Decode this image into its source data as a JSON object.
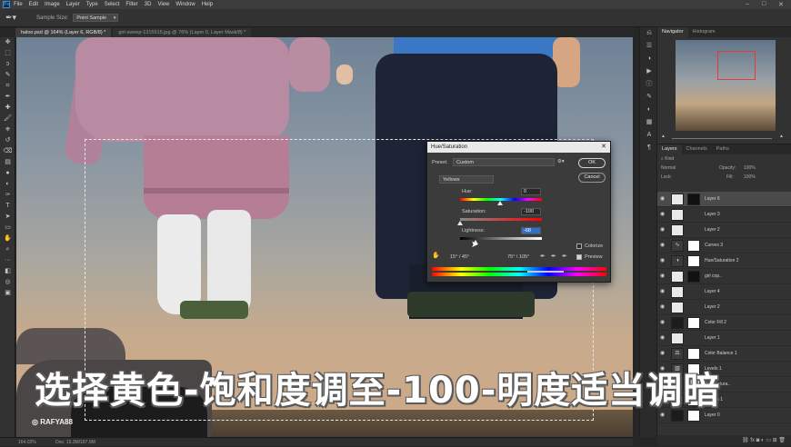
{
  "menubar": {
    "logo": "Ps",
    "items": [
      "File",
      "Edit",
      "Image",
      "Layer",
      "Type",
      "Select",
      "Filter",
      "3D",
      "View",
      "Window",
      "Help"
    ]
  },
  "options": {
    "sample_size_label": "Sample Size:",
    "sample_size_value": "Point Sample"
  },
  "tabs": [
    {
      "label": "haloo.psd @ 164% (Layer 6, RGB/8) *"
    },
    {
      "label": "girl-sweep-1315515.jpg @ 76% (Layer 0, Layer Mask/8) *"
    }
  ],
  "status": {
    "zoom": "164.02%",
    "doc": "Doc: 15.3M/187.9M"
  },
  "dialog": {
    "title": "Hue/Saturation",
    "preset_label": "Preset:",
    "preset_value": "Custom",
    "ok": "OK",
    "cancel": "Cancel",
    "channel": "Yellows",
    "hue_label": "Hue:",
    "hue_value": "0",
    "saturation_label": "Saturation:",
    "saturation_value": "-100",
    "lightness_label": "Lightness:",
    "lightness_value": "-68",
    "colorize_label": "Colorize",
    "preview_label": "Preview",
    "range_left": "15° / 45°",
    "range_right": "75° \\ 105°"
  },
  "navigator": {
    "tabs": [
      "Navigator",
      "Histogram"
    ]
  },
  "layers_panel": {
    "tabs": [
      "Layers",
      "Channels",
      "Paths"
    ],
    "kind_label": "Kind",
    "blend_mode": "Normal",
    "opacity_label": "Opacity:",
    "opacity_value": "100%",
    "lock_label": "Lock:",
    "fill_label": "Fill:",
    "fill_value": "100%",
    "layers": [
      {
        "name": "Layer 6",
        "selected": true
      },
      {
        "name": "Layer 3",
        "selected": false
      },
      {
        "name": "Layer 2",
        "selected": false
      },
      {
        "name": "Curves 3",
        "selected": false
      },
      {
        "name": "Hue/Saturation 2",
        "selected": false
      },
      {
        "name": "girl cop..",
        "selected": false
      },
      {
        "name": "Layer 4",
        "selected": false
      },
      {
        "name": "Layer 2",
        "selected": false
      },
      {
        "name": "Color Fill 2",
        "selected": false
      },
      {
        "name": "Layer 1",
        "selected": false
      },
      {
        "name": "Color Balance 1",
        "selected": false
      },
      {
        "name": "Levels 1",
        "selected": false
      },
      {
        "name": "Hue/Satura..",
        "selected": false
      },
      {
        "name": "Curves 1",
        "selected": false
      },
      {
        "name": "Layer 0",
        "selected": false
      }
    ]
  },
  "subtitle": "选择黄色-饱和度调至-100-明度适当调暗",
  "watermark": "RAFYA88"
}
